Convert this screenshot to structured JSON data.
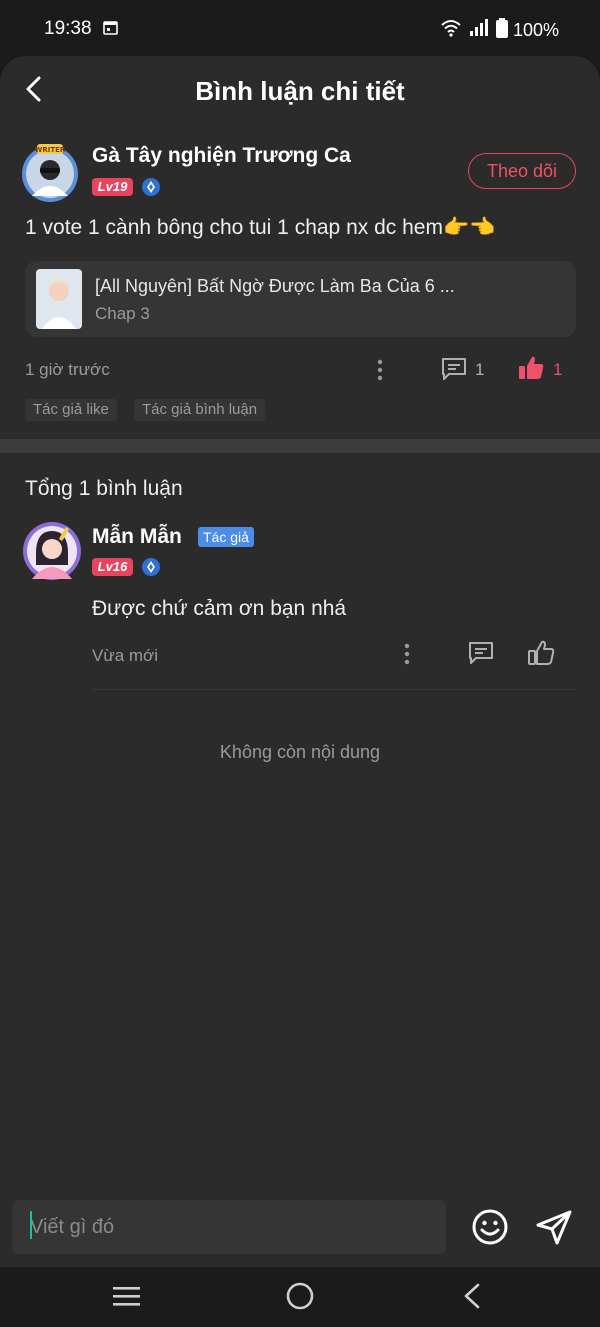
{
  "status_bar": {
    "time": "19:38",
    "battery": "100%"
  },
  "header": {
    "title": "Bình luận chi tiết"
  },
  "comment": {
    "author": "Gà Tây nghiện Trương Ca",
    "level": "Lv19",
    "follow_label": "Theo dõi",
    "text": "1 vote 1 cành bông cho tui 1 chap nx dc hem👉👈",
    "chapter_card": {
      "title": "[All Nguyên] Bất Ngờ Được Làm Ba Của 6 ...",
      "chapter": "Chap 3"
    },
    "time": "1 giờ trước",
    "reply_count": "1",
    "like_count": "1",
    "tags": [
      "Tác giả like",
      "Tác giả bình luận"
    ]
  },
  "replies": {
    "total_label": "Tổng 1 bình luận",
    "items": [
      {
        "author": "Mẫn Mẫn",
        "badge": "Tác giả",
        "level": "Lv16",
        "text": "Được chứ cảm ơn bạn nhá",
        "time": "Vừa mới"
      }
    ],
    "end_label": "Không còn nội dung"
  },
  "composer": {
    "placeholder": "Viết gì đó"
  },
  "icons": {
    "back": "chevron-left-icon",
    "more": "more-vertical-icon",
    "comment": "comment-icon",
    "like": "thumbs-up-icon",
    "emoji": "smiley-icon",
    "send": "send-icon"
  },
  "colors": {
    "accent": "#e8445e",
    "author_badge": "#4b8de8",
    "background": "#2b2b2b"
  }
}
